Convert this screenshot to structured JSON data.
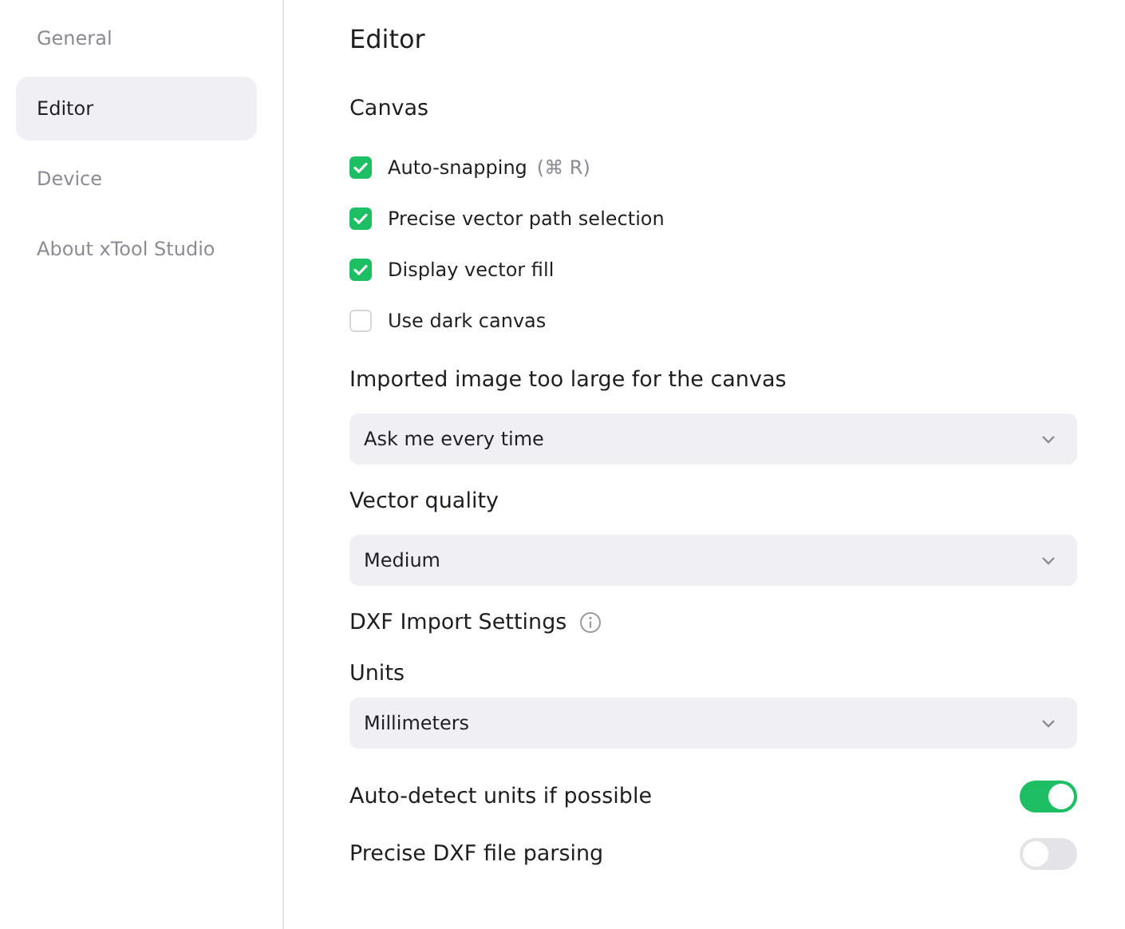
{
  "sidebar": {
    "items": [
      {
        "label": "General",
        "selected": false
      },
      {
        "label": "Editor",
        "selected": true
      },
      {
        "label": "Device",
        "selected": false
      },
      {
        "label": "About xTool Studio",
        "selected": false
      }
    ]
  },
  "page_title": "Editor",
  "blocks": [
    {
      "kind": "heading",
      "label": "Canvas"
    },
    {
      "kind": "checkbox",
      "label": "Auto-snapping",
      "shortcut": "(⌘ R)",
      "checked": true
    },
    {
      "kind": "checkbox",
      "label": "Precise vector path selection",
      "checked": true
    },
    {
      "kind": "checkbox",
      "label": "Display vector fill",
      "checked": true
    },
    {
      "kind": "checkbox",
      "label": "Use dark canvas",
      "checked": false
    },
    {
      "kind": "heading",
      "label": "Imported image too large for the canvas"
    },
    {
      "kind": "select",
      "value": "Ask me every time"
    },
    {
      "kind": "heading",
      "label": "Vector quality"
    },
    {
      "kind": "select",
      "value": "Medium"
    },
    {
      "kind": "heading",
      "label": "DXF Import Settings",
      "info": true
    },
    {
      "kind": "label",
      "label": "Units"
    },
    {
      "kind": "select",
      "value": "Millimeters"
    },
    {
      "kind": "toggle",
      "label": "Auto-detect units if possible",
      "on": true
    },
    {
      "kind": "toggle",
      "label": "Precise DXF file parsing",
      "on": false
    }
  ]
}
